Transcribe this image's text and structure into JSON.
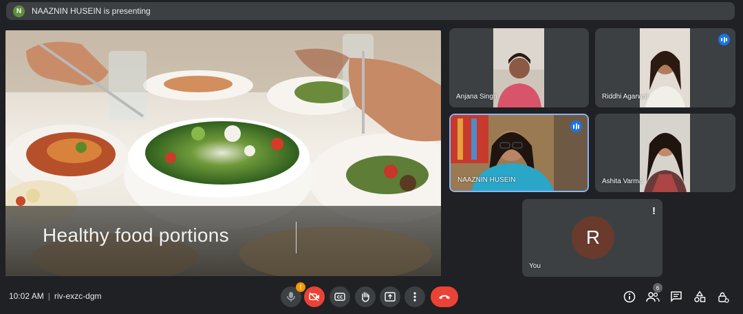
{
  "banner": {
    "initial": "N",
    "text": "NAAZNIN HUSEIN is presenting"
  },
  "presentation": {
    "slide_title": "Healthy food portions"
  },
  "participants": [
    {
      "name": "Anjana Singh",
      "speaking": false
    },
    {
      "name": "Riddhi Agarwal",
      "speaking": true
    },
    {
      "name": "NAAZNIN HUSEIN",
      "speaking": true
    },
    {
      "name": "Ashita Varma",
      "speaking": false
    }
  ],
  "self_tile": {
    "initial": "R",
    "name": "You",
    "alert": "!"
  },
  "bottom_bar": {
    "time": "10:02 AM",
    "separator": "|",
    "meeting_code": "riv-exzc-dgm",
    "mic_alert": "!",
    "people_count": "6"
  },
  "icons": [
    "mic-icon",
    "camera-off-icon",
    "captions-icon",
    "raise-hand-icon",
    "present-icon",
    "more-options-icon",
    "end-call-icon",
    "info-icon",
    "people-icon",
    "chat-icon",
    "activities-icon",
    "host-controls-icon"
  ]
}
